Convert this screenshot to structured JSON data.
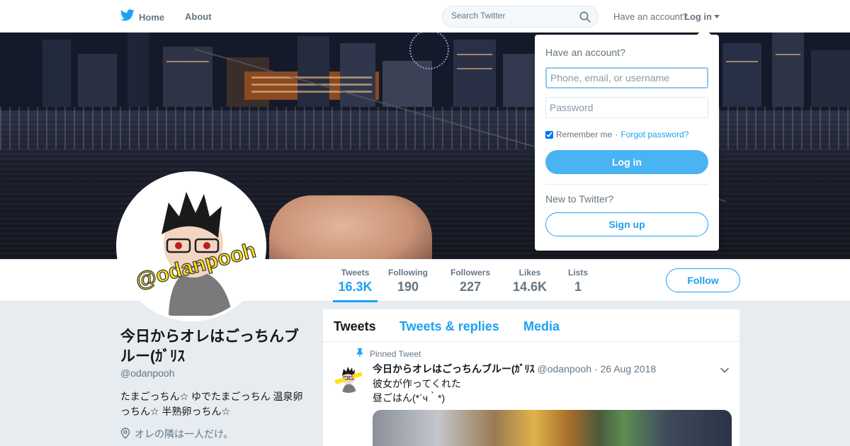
{
  "topnav": {
    "home_label": "Home",
    "about_label": "About",
    "search_placeholder": "Search Twitter",
    "have_account": "Have an account?",
    "login_label": "Log in"
  },
  "login_dropdown": {
    "title": "Have an account?",
    "username_placeholder": "Phone, email, or username",
    "password_placeholder": "Password",
    "remember_label": "Remember me",
    "separator": "·",
    "forgot_label": "Forgot password?",
    "login_button": "Log in",
    "new_prompt": "New to Twitter?",
    "signup_button": "Sign up",
    "remember_checked": true
  },
  "avatar": {
    "overlay_text": "@odanpooh"
  },
  "stats": [
    {
      "label": "Tweets",
      "value": "16.3K",
      "active": true
    },
    {
      "label": "Following",
      "value": "190",
      "active": false
    },
    {
      "label": "Followers",
      "value": "227",
      "active": false
    },
    {
      "label": "Likes",
      "value": "14.6K",
      "active": false
    },
    {
      "label": "Lists",
      "value": "1",
      "active": false
    }
  ],
  "follow_button": "Follow",
  "profile": {
    "name": "今日からオレはごっちんブルー(ｶﾞﾘｽ",
    "handle": "@odanpooh",
    "bio": "たまごっちん☆ ゆでたまごっちん 温泉卵っちん☆ 半熟卵っちん☆",
    "location": "オレの隣は一人だけ。"
  },
  "timeline": {
    "tabs": [
      "Tweets",
      "Tweets & replies",
      "Media"
    ],
    "active_tab": "Tweets",
    "tweet": {
      "pinned_label": "Pinned Tweet",
      "author_name": "今日からオレはごっちんブルー(ｶﾞﾘｽ",
      "author_handle": "@odanpooh",
      "date": "· 26 Aug 2018",
      "text_line1": "彼女が作ってくれた",
      "text_line2": "昼ごはん(*´ч｀*)"
    }
  },
  "colors": {
    "accent": "#1da1f2",
    "login_button": "#4ab3f4",
    "muted_text": "#657786",
    "page_bg": "#e6ecf0"
  }
}
